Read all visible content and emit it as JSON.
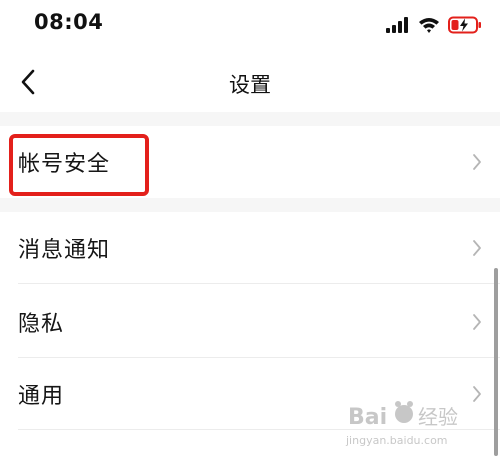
{
  "status_bar": {
    "time": "08:04",
    "icons": [
      "signal-icon",
      "wifi-icon",
      "battery-charging-icon"
    ],
    "battery_color": "#e3201b"
  },
  "header": {
    "title": "设置",
    "back_icon": "chevron-left-icon"
  },
  "settings": {
    "items": [
      {
        "label": "帐号安全",
        "icon": "chevron-right-icon"
      },
      {
        "label": "消息通知",
        "icon": "chevron-right-icon"
      },
      {
        "label": "隐私",
        "icon": "chevron-right-icon"
      },
      {
        "label": "通用",
        "icon": "chevron-right-icon"
      }
    ]
  },
  "annotation": {
    "color": "#e3201b",
    "target": "帐号安全"
  },
  "watermark": {
    "text": "Bai经验",
    "url": "jingyan.baidu.com"
  }
}
